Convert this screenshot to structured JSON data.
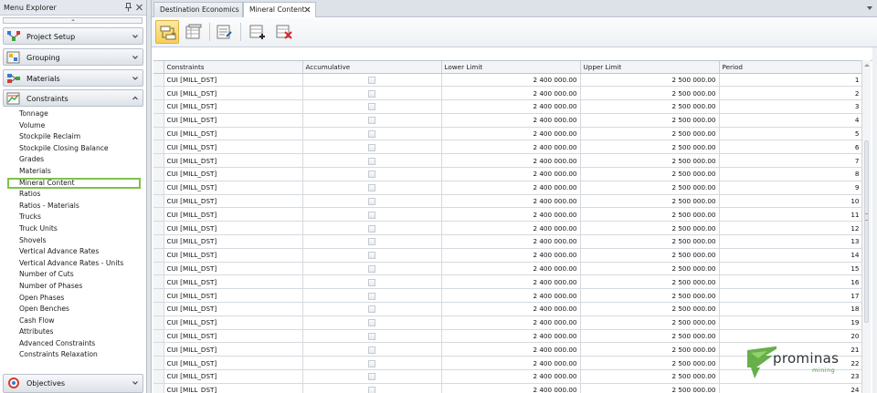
{
  "menu": {
    "title": "Menu Explorer",
    "groups": [
      {
        "label": "Project Setup",
        "icon": "project-setup-icon"
      },
      {
        "label": "Grouping",
        "icon": "grouping-icon"
      },
      {
        "label": "Materials",
        "icon": "materials-icon"
      },
      {
        "label": "Constraints",
        "icon": "constraints-icon",
        "expanded": true
      },
      {
        "label": "Objectives",
        "icon": "objectives-icon"
      }
    ],
    "items": [
      "Tonnage",
      "Volume",
      "Stockpile Reclaim",
      "Stockpile Closing Balance",
      "Grades",
      "Materials",
      "Mineral Content",
      "Ratios",
      "Ratios - Materials",
      "Trucks",
      "Truck Units",
      "Shovels",
      "Vertical Advance Rates",
      "Vertical Advance Rates - Units",
      "Number of Cuts",
      "Number of Phases",
      "Open Phases",
      "Open Benches",
      "Cash Flow",
      "Attributes",
      "Advanced Constraints",
      "Constraints Relaxation"
    ],
    "selected_item": "Mineral Content"
  },
  "tabs": [
    {
      "label": "Destination Economics",
      "active": false
    },
    {
      "label": "Mineral Content",
      "active": true
    }
  ],
  "toolbar": {
    "buttons": [
      "toggle-view",
      "grid-view",
      "edit-list",
      "add-row",
      "delete-row"
    ]
  },
  "grid": {
    "columns": [
      "Constraints",
      "Accumulative",
      "Lower Limit",
      "Upper Limit",
      "Period"
    ],
    "rows": [
      [
        "CUI [MILL_DST]",
        "",
        "2 400 000.00",
        "2 500 000.00",
        "1"
      ],
      [
        "CUI [MILL_DST]",
        "",
        "2 400 000.00",
        "2 500 000.00",
        "2"
      ],
      [
        "CUI [MILL_DST]",
        "",
        "2 400 000.00",
        "2 500 000.00",
        "3"
      ],
      [
        "CUI [MILL_DST]",
        "",
        "2 400 000.00",
        "2 500 000.00",
        "4"
      ],
      [
        "CUI [MILL_DST]",
        "",
        "2 400 000.00",
        "2 500 000.00",
        "5"
      ],
      [
        "CUI [MILL_DST]",
        "",
        "2 400 000.00",
        "2 500 000.00",
        "6"
      ],
      [
        "CUI [MILL_DST]",
        "",
        "2 400 000.00",
        "2 500 000.00",
        "7"
      ],
      [
        "CUI [MILL_DST]",
        "",
        "2 400 000.00",
        "2 500 000.00",
        "8"
      ],
      [
        "CUI [MILL_DST]",
        "",
        "2 400 000.00",
        "2 500 000.00",
        "9"
      ],
      [
        "CUI [MILL_DST]",
        "",
        "2 400 000.00",
        "2 500 000.00",
        "10"
      ],
      [
        "CUI [MILL_DST]",
        "",
        "2 400 000.00",
        "2 500 000.00",
        "11"
      ],
      [
        "CUI [MILL_DST]",
        "",
        "2 400 000.00",
        "2 500 000.00",
        "12"
      ],
      [
        "CUI [MILL_DST]",
        "",
        "2 400 000.00",
        "2 500 000.00",
        "13"
      ],
      [
        "CUI [MILL_DST]",
        "",
        "2 400 000.00",
        "2 500 000.00",
        "14"
      ],
      [
        "CUI [MILL_DST]",
        "",
        "2 400 000.00",
        "2 500 000.00",
        "15"
      ],
      [
        "CUI [MILL_DST]",
        "",
        "2 400 000.00",
        "2 500 000.00",
        "16"
      ],
      [
        "CUI [MILL_DST]",
        "",
        "2 400 000.00",
        "2 500 000.00",
        "17"
      ],
      [
        "CUI [MILL_DST]",
        "",
        "2 400 000.00",
        "2 500 000.00",
        "18"
      ],
      [
        "CUI [MILL_DST]",
        "",
        "2 400 000.00",
        "2 500 000.00",
        "19"
      ],
      [
        "CUI [MILL_DST]",
        "",
        "2 400 000.00",
        "2 500 000.00",
        "20"
      ],
      [
        "CUI [MILL_DST]",
        "",
        "2 400 000.00",
        "2 500 000.00",
        "21"
      ],
      [
        "CUI [MILL_DST]",
        "",
        "2 400 000.00",
        "2 500 000.00",
        "22"
      ],
      [
        "CUI [MILL_DST]",
        "",
        "2 400 000.00",
        "2 500 000.00",
        "23"
      ],
      [
        "CUI [MILL_DST]",
        "",
        "2 400 000.00",
        "2 500 000.00",
        "24"
      ]
    ]
  },
  "logo": {
    "name": "prominas",
    "sub": "mining",
    "color": "#5aa83c"
  },
  "colors": {
    "selection_outline": "#7ec24b",
    "active_button": "#f7cf5a"
  }
}
